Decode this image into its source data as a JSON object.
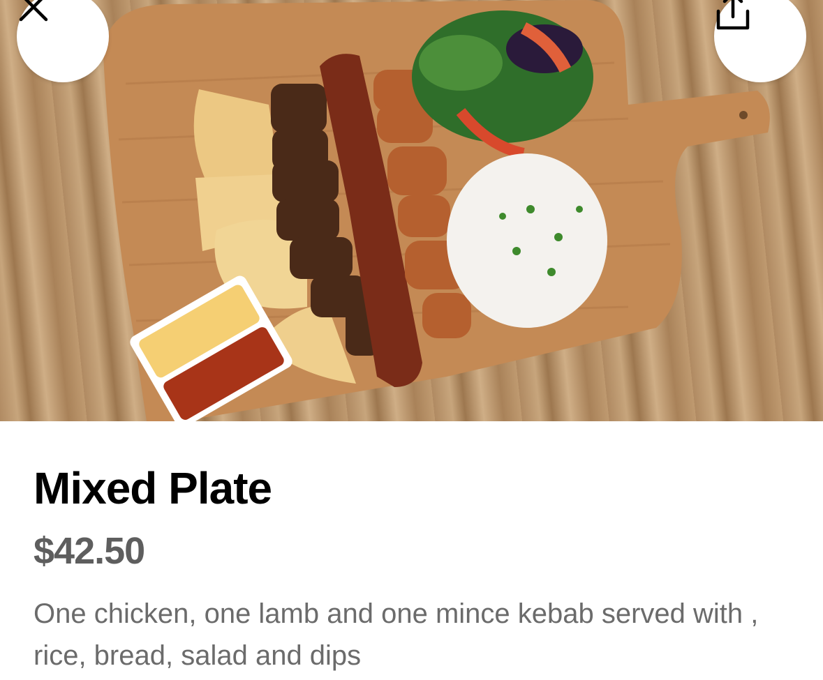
{
  "header": {
    "close_icon": "close-icon",
    "share_icon": "share-icon"
  },
  "hero_image": {
    "subject": "food-photo"
  },
  "item": {
    "name": "Mixed Plate",
    "price": "$42.50",
    "description": "One chicken, one lamb and one mince kebab served with , rice, bread, salad and dips"
  },
  "colors": {
    "title": "#000000",
    "price": "#5e5e5e",
    "description": "#6b6b6b",
    "button_bg": "#ffffff"
  }
}
